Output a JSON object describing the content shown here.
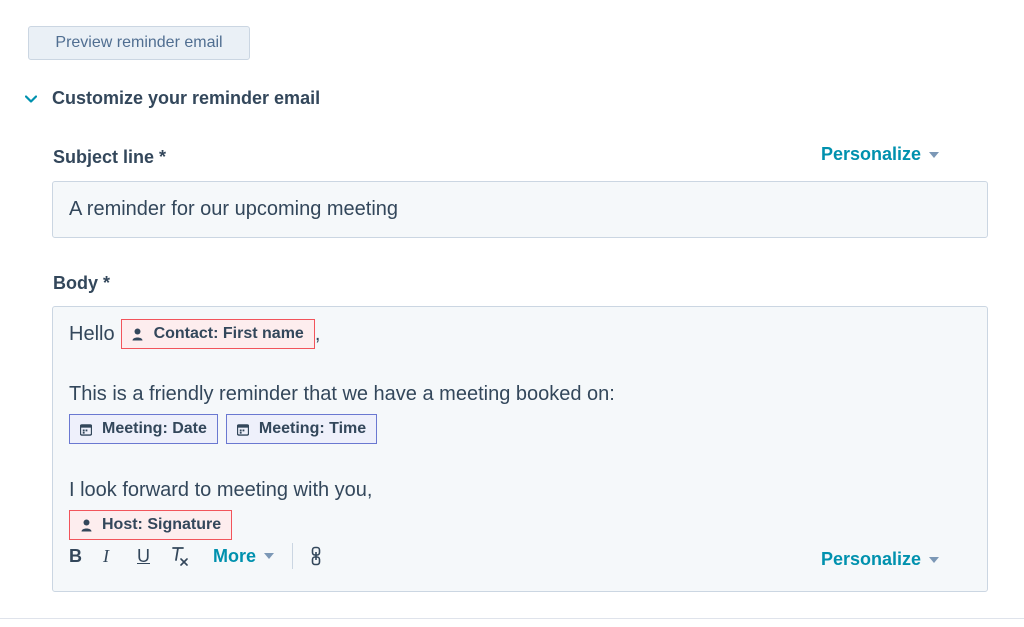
{
  "preview_button": {
    "label": "Preview reminder email"
  },
  "section": {
    "title": "Customize your reminder email",
    "icon": "chevron-down-icon"
  },
  "subject": {
    "label": "Subject line *",
    "value": "A reminder for our upcoming meeting",
    "personalize_label": "Personalize"
  },
  "body": {
    "label": "Body *",
    "greeting": "Hello",
    "greeting_punct": ",",
    "line2": "This is a friendly reminder that we have a meeting booked on:",
    "line3": "I look forward to meeting with you,",
    "tokens": {
      "contact_first_name": "Contact: First name",
      "meeting_date": "Meeting: Date",
      "meeting_time": "Meeting: Time",
      "host_signature": "Host: Signature"
    },
    "toolbar": {
      "bold": "B",
      "italic": "I",
      "underline": "U",
      "more_label": "More",
      "personalize_label": "Personalize"
    }
  },
  "colors": {
    "accent": "#0091ae",
    "text": "#33475b",
    "contact_token_border": "#f2545b",
    "meeting_token_border": "#6a78d1",
    "input_bg": "#f5f8fa"
  }
}
